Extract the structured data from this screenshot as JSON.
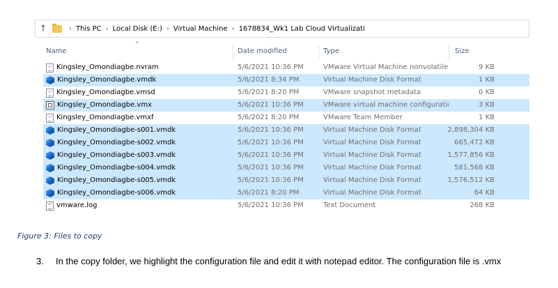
{
  "breadcrumb": {
    "items": [
      "This PC",
      "Local Disk (E:)",
      "Virtual Machine",
      "1678834_Wk1 Lab Cloud Virtualizati"
    ]
  },
  "columns": {
    "name": "Name",
    "date": "Date modified",
    "type": "Type",
    "size": "Size"
  },
  "files": [
    {
      "icon": "document-icon",
      "name": "Kingsley_Omondiagbe.nvram",
      "date": "5/6/2021 10:36 PM",
      "type": "VMware Virtual Machine nonvolatile ...",
      "size": "9 KB",
      "selected": false
    },
    {
      "icon": "vmdk-cube-icon",
      "name": "Kingsley_Omondiagbe.vmdk",
      "date": "5/6/2021 8:34 PM",
      "type": "Virtual Machine Disk Format",
      "size": "1 KB",
      "selected": true
    },
    {
      "icon": "document-icon",
      "name": "Kingsley_Omondiagbe.vmsd",
      "date": "5/6/2021 8:20 PM",
      "type": "VMware snapshot metadata",
      "size": "0 KB",
      "selected": false
    },
    {
      "icon": "vmx-config-icon",
      "name": "Kingsley_Omondiagbe.vmx",
      "date": "5/6/2021 10:36 PM",
      "type": "VMware virtual machine configuration",
      "size": "3 KB",
      "selected": true
    },
    {
      "icon": "document-icon",
      "name": "Kingsley_Omondiagbe.vmxf",
      "date": "5/6/2021 8:20 PM",
      "type": "VMware Team Member",
      "size": "1 KB",
      "selected": false
    },
    {
      "icon": "vmdk-cube-icon",
      "name": "Kingsley_Omondiagbe-s001.vmdk",
      "date": "5/6/2021 10:36 PM",
      "type": "Virtual Machine Disk Format",
      "size": "2,898,304 KB",
      "selected": true
    },
    {
      "icon": "vmdk-cube-icon",
      "name": "Kingsley_Omondiagbe-s002.vmdk",
      "date": "5/6/2021 10:36 PM",
      "type": "Virtual Machine Disk Format",
      "size": "665,472 KB",
      "selected": true
    },
    {
      "icon": "vmdk-cube-icon",
      "name": "Kingsley_Omondiagbe-s003.vmdk",
      "date": "5/6/2021 10:36 PM",
      "type": "Virtual Machine Disk Format",
      "size": "1,577,856 KB",
      "selected": true
    },
    {
      "icon": "vmdk-cube-icon",
      "name": "Kingsley_Omondiagbe-s004.vmdk",
      "date": "5/6/2021 10:36 PM",
      "type": "Virtual Machine Disk Format",
      "size": "581,568 KB",
      "selected": true
    },
    {
      "icon": "vmdk-cube-icon",
      "name": "Kingsley_Omondiagbe-s005.vmdk",
      "date": "5/6/2021 10:36 PM",
      "type": "Virtual Machine Disk Format",
      "size": "1,576,512 KB",
      "selected": true
    },
    {
      "icon": "vmdk-cube-icon",
      "name": "Kingsley_Omondiagbe-s006.vmdk",
      "date": "5/6/2021 8:20 PM",
      "type": "Virtual Machine Disk Format",
      "size": "64 KB",
      "selected": true
    },
    {
      "icon": "log-file-icon",
      "name": "vmware.log",
      "date": "5/6/2021 10:36 PM",
      "type": "Text Document",
      "size": "268 KB",
      "selected": false
    }
  ],
  "caption": "Figure 3: Files to copy",
  "step": {
    "number": "3.",
    "text": "In the copy folder, we highlight the configuration file and edit it with notepad editor. The configuration file is .vmx"
  }
}
